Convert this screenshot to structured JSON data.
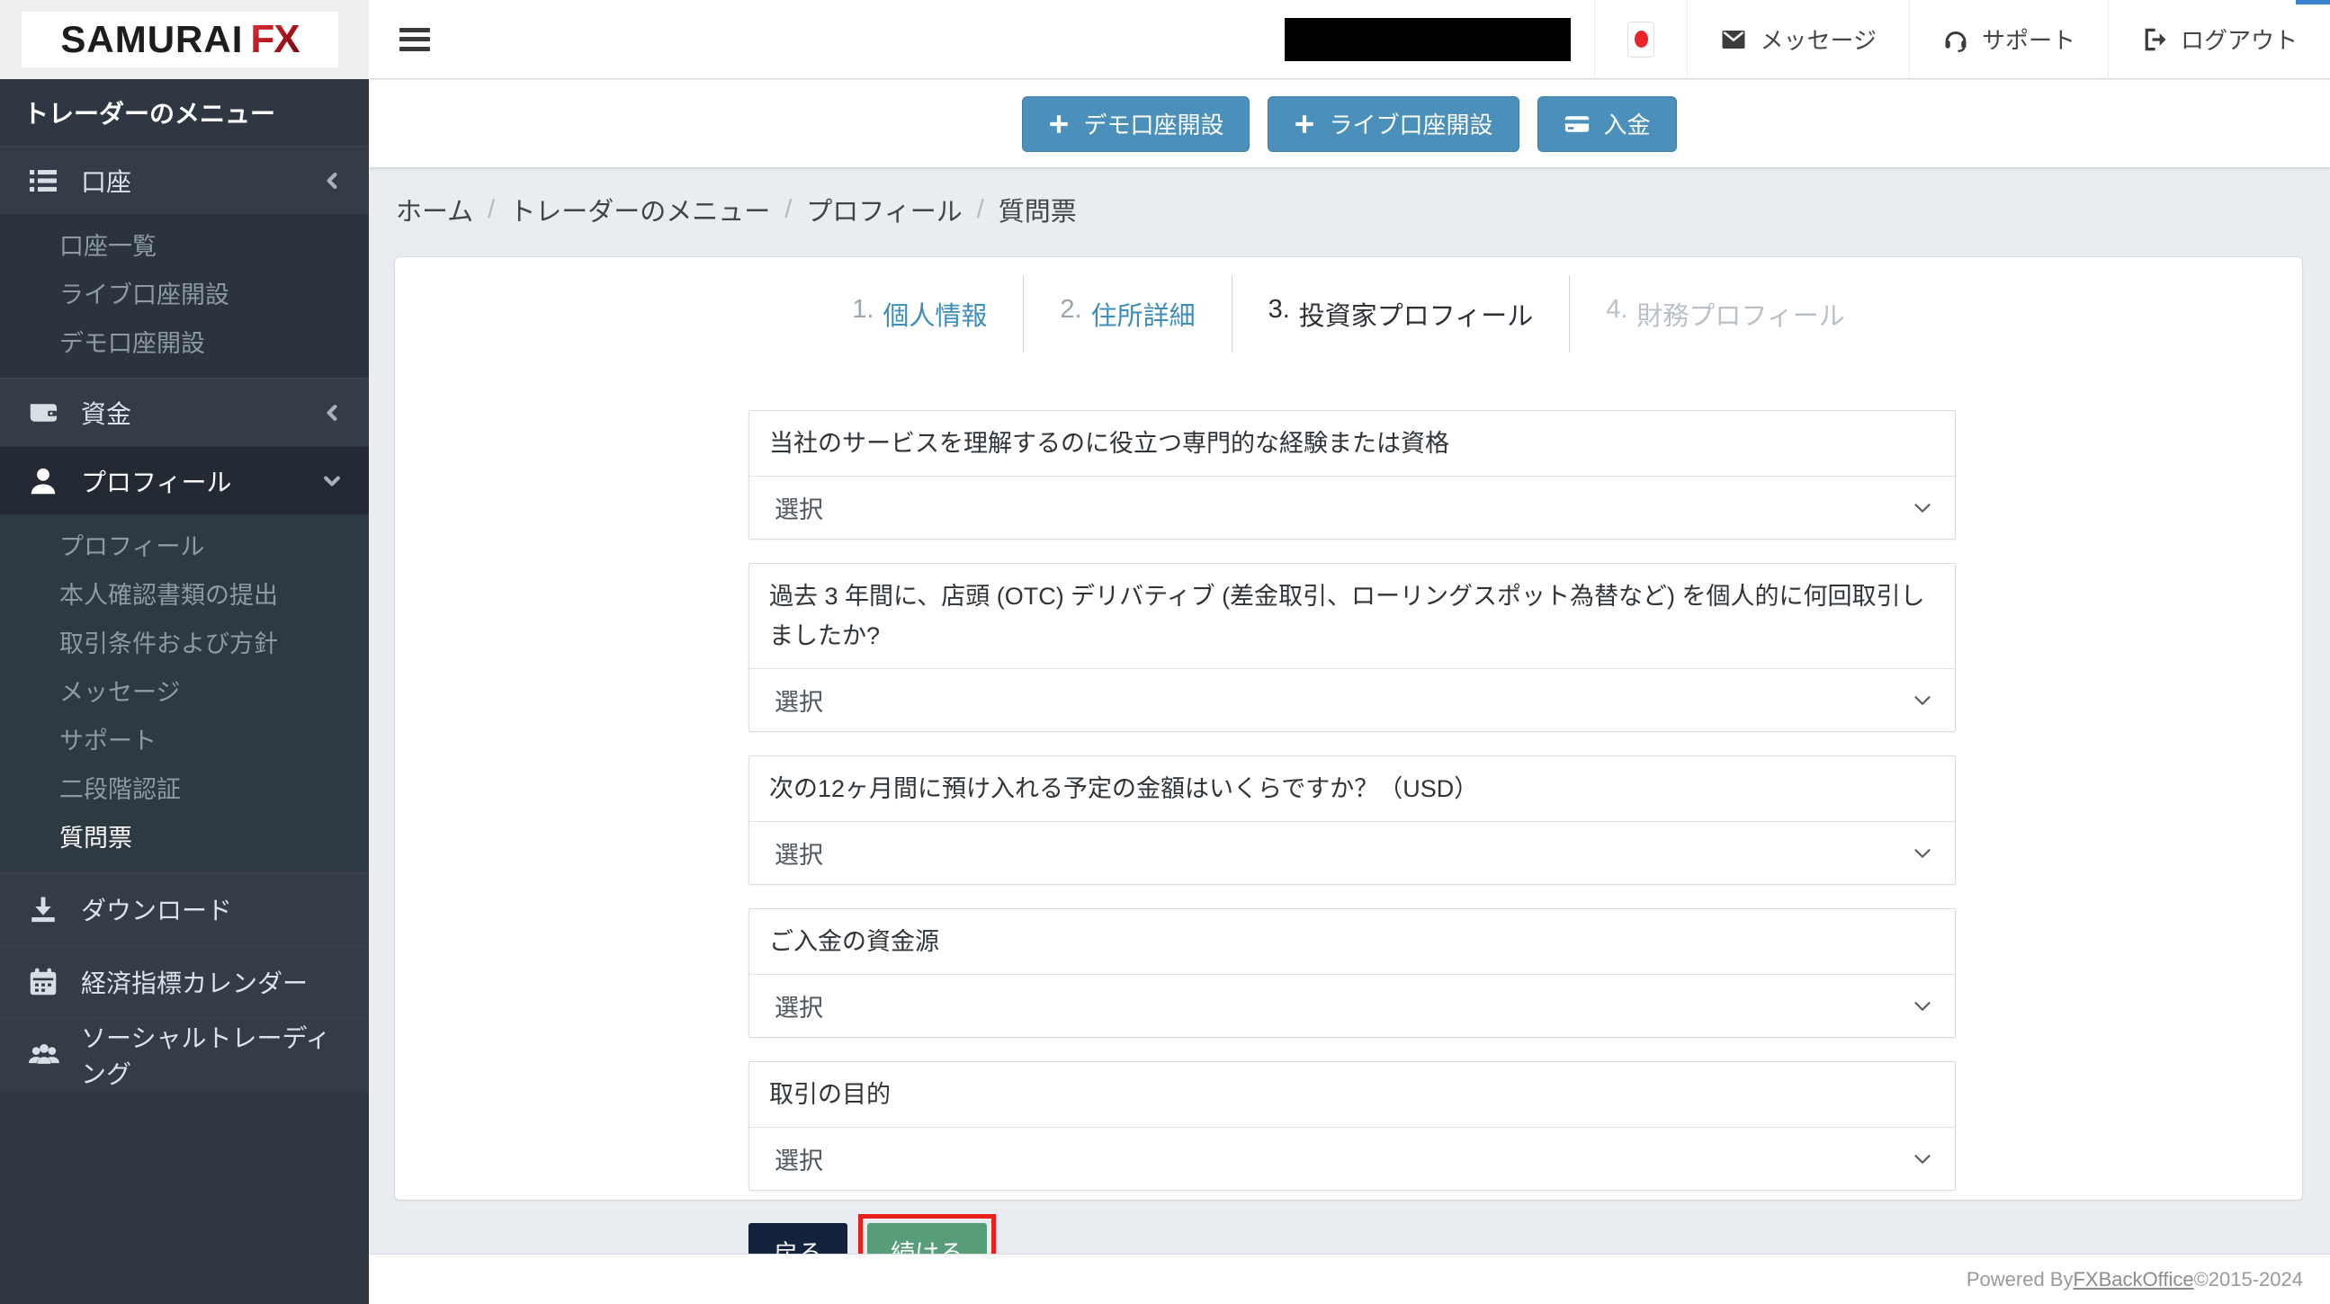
{
  "colors": {
    "sidebar_bg": "#2e3742",
    "sidebar_group_bg": "#333c47",
    "sidebar_submenu_bg": "#2b333d",
    "sidebar_expanded_bg": "#232a33",
    "sidebar_expanded_submenu_bg": "#2e3a41",
    "accent_blue": "#4a90ba",
    "link_blue": "#3c8dbc",
    "navy_button": "#13233c",
    "green_button": "#579d79",
    "highlight_red": "#e8211d",
    "content_bg": "#e9ecf0",
    "logo_red": "#c71f25",
    "flag_red": "#e8252b"
  },
  "brand": {
    "name_part1": "SAMURAI",
    "name_part2": "FX"
  },
  "sidebar": {
    "title": "トレーダーのメニュー",
    "groups": [
      {
        "label": "口座",
        "icon": "list-icon",
        "chevron": "left",
        "children": [
          "口座一覧",
          "ライブ口座開設",
          "デモ口座開設"
        ]
      },
      {
        "label": "資金",
        "icon": "wallet-icon",
        "chevron": "left",
        "children": []
      },
      {
        "label": "プロフィール",
        "icon": "user-icon",
        "chevron": "down",
        "children": [
          "プロフィール",
          "本人確認書類の提出",
          "取引条件および方針",
          "メッセージ",
          "サポート",
          "二段階認証",
          "質問票"
        ],
        "active_child_index": 6
      },
      {
        "label": "ダウンロード",
        "icon": "download-icon"
      },
      {
        "label": "経済指標カレンダー",
        "icon": "calendar-icon"
      },
      {
        "label": "ソーシャルトレーディング",
        "icon": "users-icon"
      }
    ]
  },
  "topbar": {
    "hamburger_icon": "hamburger-icon",
    "flag_icon": "japan-flag-icon",
    "items": [
      {
        "label": "メッセージ",
        "icon": "envelope-icon"
      },
      {
        "label": "サポート",
        "icon": "headset-icon"
      },
      {
        "label": "ログアウト",
        "icon": "logout-icon"
      }
    ]
  },
  "action_buttons": [
    {
      "label": "デモ口座開設",
      "icon": "plus-icon"
    },
    {
      "label": "ライブ口座開設",
      "icon": "plus-icon"
    },
    {
      "label": "入金",
      "icon": "credit-card-icon"
    }
  ],
  "breadcrumb": {
    "separator": "/",
    "items": [
      "ホーム",
      "トレーダーのメニュー",
      "プロフィール",
      "質問票"
    ]
  },
  "wizard": {
    "steps": [
      {
        "number": "1.",
        "label": "個人情報",
        "state": "link"
      },
      {
        "number": "2.",
        "label": "住所詳細",
        "state": "link"
      },
      {
        "number": "3.",
        "label": "投資家プロフィール",
        "state": "current"
      },
      {
        "number": "4.",
        "label": "財務プロフィール",
        "state": "disabled"
      }
    ]
  },
  "form": {
    "select_placeholder": "選択",
    "fields": [
      {
        "label": "当社のサービスを理解するのに役立つ専門的な経験または資格",
        "value": "選択"
      },
      {
        "label": "過去 3 年間に、店頭 (OTC) デリバティブ (差金取引、ローリングスポット為替など) を個人的に何回取引しましたか?",
        "value": "選択"
      },
      {
        "label": "次の12ヶ月間に預け入れる予定の金額はいくらですか？（USD）",
        "value": "選択"
      },
      {
        "label": "ご入金の資金源",
        "value": "選択"
      },
      {
        "label": "取引の目的",
        "value": "選択"
      }
    ],
    "back_label": "戻る",
    "continue_label": "続ける"
  },
  "footer": {
    "prefix": "Powered By ",
    "link_label": "FXBackOffice",
    "suffix": " ©2015-2024"
  }
}
